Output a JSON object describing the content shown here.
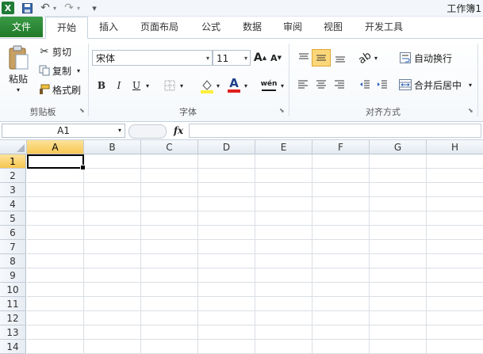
{
  "titlebar": {
    "title": "工作簿1",
    "app_icon": "X",
    "save_icon": "save-icon",
    "undo_icon": "↶",
    "redo_icon": "↷",
    "customize_icon": "▾"
  },
  "tabs": [
    {
      "label": "文件"
    },
    {
      "label": "开始"
    },
    {
      "label": "插入"
    },
    {
      "label": "页面布局"
    },
    {
      "label": "公式"
    },
    {
      "label": "数据"
    },
    {
      "label": "审阅"
    },
    {
      "label": "视图"
    },
    {
      "label": "开发工具"
    }
  ],
  "clipboard": {
    "paste": "粘贴",
    "cut": "剪切",
    "copy": "复制",
    "format_painter": "格式刷",
    "group": "剪贴板"
  },
  "font": {
    "name": "宋体",
    "size": "11",
    "grow": "A",
    "shrink": "A",
    "bold": "B",
    "italic": "I",
    "underline": "U",
    "phonetic": "wén",
    "group": "字体",
    "font_color": "#e02020",
    "highlight_color": "#ffef3a"
  },
  "alignment": {
    "wrap": "自动换行",
    "merge": "合并后居中",
    "group": "对齐方式"
  },
  "formula_bar": {
    "name_box": "A1",
    "fx": "fx",
    "value": ""
  },
  "sheet": {
    "columns": [
      "A",
      "B",
      "C",
      "D",
      "E",
      "F",
      "G",
      "H"
    ],
    "rows": [
      "1",
      "2",
      "3",
      "4",
      "5",
      "6",
      "7",
      "8",
      "9",
      "10",
      "11",
      "12",
      "13",
      "14"
    ],
    "active_cell": "A1"
  },
  "colors": {
    "file_tab": "#217a2b",
    "active_header": "#f7c652"
  }
}
